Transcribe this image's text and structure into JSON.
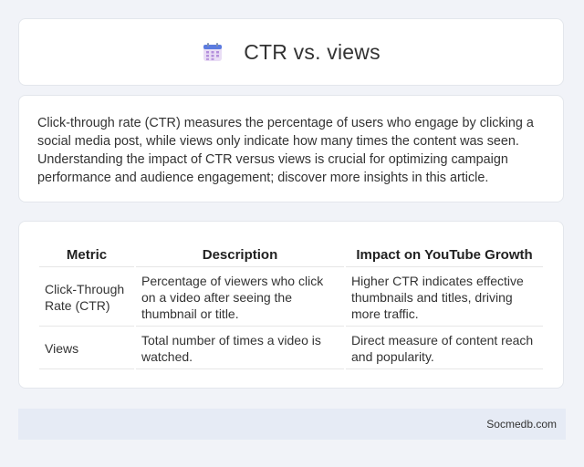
{
  "header": {
    "title": "CTR vs. views",
    "icon": "calendar-icon"
  },
  "intro": {
    "text": "Click-through rate (CTR) measures the percentage of users who engage by clicking a social media post, while views only indicate how many times the content was seen. Understanding the impact of CTR versus views is crucial for optimizing campaign performance and audience engagement; discover more insights in this article."
  },
  "table": {
    "headers": [
      "Metric",
      "Description",
      "Impact on YouTube Growth"
    ],
    "rows": [
      [
        "Click-Through Rate (CTR)",
        "Percentage of viewers who click on a video after seeing the thumbnail or title.",
        "Higher CTR indicates effective thumbnails and titles, driving more traffic."
      ],
      [
        "Views",
        "Total number of times a video is watched.",
        "Direct measure of content reach and popularity."
      ]
    ]
  },
  "footer": {
    "text": "Socmedb.com"
  },
  "colors": {
    "background": "#f1f3f8",
    "card": "#ffffff",
    "footer": "#e6ebf5",
    "icon_top": "#5b7be0",
    "icon_body": "#e9ddf5",
    "icon_dots": "#b48fdc"
  }
}
